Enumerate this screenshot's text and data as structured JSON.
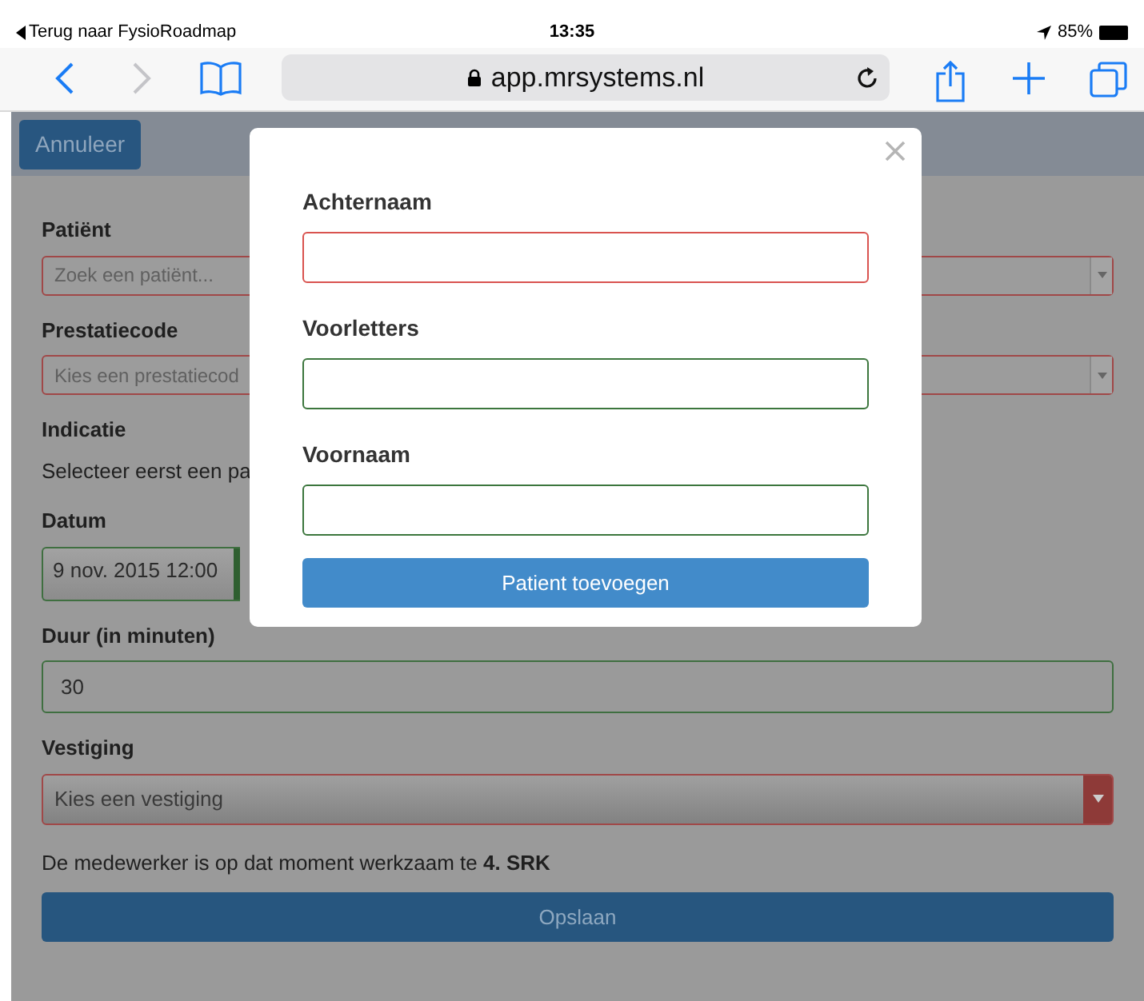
{
  "status_bar": {
    "back_link": "Terug naar FysioRoadmap",
    "time": "13:35",
    "battery": "85%"
  },
  "browser": {
    "url": "app.mrsystems.nl"
  },
  "header": {
    "cancel_button": "Annuleer"
  },
  "form": {
    "fields": [
      {
        "label": "Patiënt",
        "kind": "select",
        "placeholder": "Zoek een patiënt...",
        "invalid": true
      },
      {
        "label": "Prestatiecode",
        "kind": "select",
        "placeholder": "Kies een prestatiecod",
        "invalid": true
      },
      {
        "label": "Indicatie",
        "kind": "text",
        "text": "Selecteer eerst een pa"
      },
      {
        "label": "Datum",
        "kind": "date",
        "value": "9 nov. 2015 12:00",
        "invalid": false
      },
      {
        "label": "Duur (in minuten)",
        "kind": "input",
        "value": "30",
        "invalid": false
      },
      {
        "label": "Vestiging",
        "kind": "dropdown",
        "placeholder": "Kies een vestiging",
        "invalid": true
      }
    ],
    "note": "De medewerker is op dat moment werkzaam te **4. SRK**",
    "save_button": "Opslaan"
  },
  "modal": {
    "fields": [
      {
        "label": "Achternaam",
        "invalid": true
      },
      {
        "label": "Voorletters",
        "invalid": false
      },
      {
        "label": "Voornaam",
        "invalid": false
      }
    ],
    "submit_button": "Patient toevoegen"
  }
}
